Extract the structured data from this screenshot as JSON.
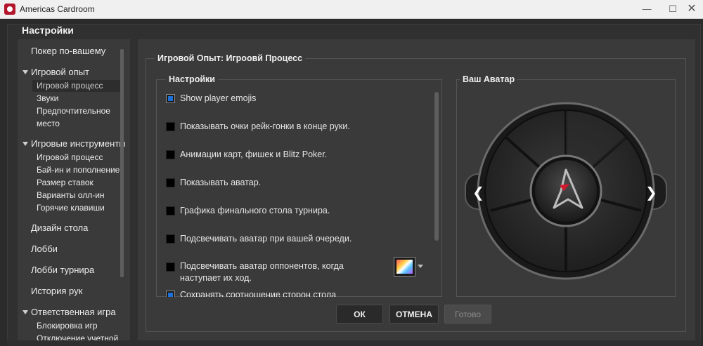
{
  "window": {
    "title": "Americas Cardroom",
    "min_icon": "minimize-icon",
    "max_icon": "maximize-icon",
    "close_icon": "close-icon"
  },
  "page": {
    "title": "Настройки"
  },
  "sidebar": {
    "items": [
      {
        "label": "Покер по-вашему",
        "level": "top"
      },
      {
        "label": "Игровой опыт",
        "level": "group",
        "expanded": true
      },
      {
        "label": "Игровой процесс",
        "level": "sub",
        "selected": true
      },
      {
        "label": "Звуки",
        "level": "sub"
      },
      {
        "label": "Предпочтительное",
        "level": "sub"
      },
      {
        "label": "место",
        "level": "sub"
      },
      {
        "label": "Игровые инструменты",
        "level": "group",
        "expanded": true
      },
      {
        "label": "Игровой процесс",
        "level": "sub"
      },
      {
        "label": "Бай-ин и пополнение",
        "level": "sub"
      },
      {
        "label": "Размер ставок",
        "level": "sub"
      },
      {
        "label": "Варианты олл-ин",
        "level": "sub"
      },
      {
        "label": "Горячие клавиши",
        "level": "sub"
      },
      {
        "label": "Дизайн стола",
        "level": "top"
      },
      {
        "label": "Лобби",
        "level": "top"
      },
      {
        "label": "Лобби турнира",
        "level": "top"
      },
      {
        "label": "История рук",
        "level": "top"
      },
      {
        "label": "Ответственная игра",
        "level": "group",
        "expanded": true
      },
      {
        "label": "Блокировка игр",
        "level": "sub"
      },
      {
        "label": "Отключение учетной",
        "level": "sub"
      }
    ]
  },
  "main": {
    "group_title": "Игровой Опыт: Игроовй Процесс",
    "settings": {
      "title": "Настройки",
      "options": [
        {
          "label": "Show player emojis",
          "checked": true
        },
        {
          "label": "Показывать очки рейк-гонки в конце руки.",
          "checked": false
        },
        {
          "label": "Анимации карт, фишек и Blitz Poker.",
          "checked": false
        },
        {
          "label": "Показывать аватар.",
          "checked": false
        },
        {
          "label": "Графика финального стола турнира.",
          "checked": false
        },
        {
          "label": "Подсвечивать аватар при вашей очереди.",
          "checked": false
        },
        {
          "label": "Подсвечивать аватар оппонентов, когда наступает их ход.",
          "checked": false
        },
        {
          "label": "Сохранять соотношение сторон стола",
          "checked": true
        }
      ]
    },
    "avatar": {
      "title": "Ваш Аватар",
      "prev_label": "❮",
      "next_label": "❯",
      "accent_color": "#d3192c"
    }
  },
  "footer": {
    "ok_label": "ОК",
    "cancel_label": "ОТМЕНА",
    "done_label": "Готово"
  }
}
